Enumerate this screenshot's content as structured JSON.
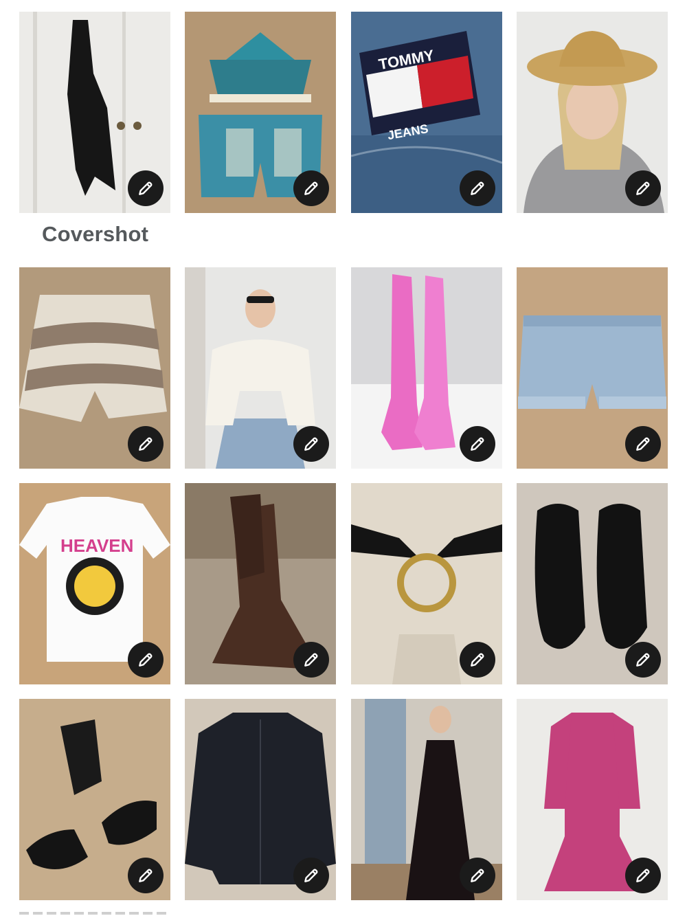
{
  "cover_label": "Covershot",
  "edit_icon": "pencil-icon",
  "colors": {
    "edit_button_bg": "#1b1b1b",
    "edit_icon": "#ffffff",
    "label": "#55595c"
  },
  "items": [
    {
      "name": "black-slip-dress",
      "brand_text": ""
    },
    {
      "name": "crochet-top-and-shorts-set",
      "brand_text": ""
    },
    {
      "name": "tommy-jeans-label",
      "brand_text": "TOMMY JEANS"
    },
    {
      "name": "woman-in-straw-hat",
      "brand_text": ""
    },
    {
      "name": "knit-striped-shorts",
      "brand_text": ""
    },
    {
      "name": "white-tie-front-top",
      "brand_text": ""
    },
    {
      "name": "pink-rain-boots",
      "brand_text": ""
    },
    {
      "name": "denim-shorts",
      "brand_text": ""
    },
    {
      "name": "heaven-graphic-tee",
      "brand_text": "HEAVEN"
    },
    {
      "name": "brown-cowboy-boots",
      "brand_text": ""
    },
    {
      "name": "black-ring-belt",
      "brand_text": ""
    },
    {
      "name": "black-suede-loafers",
      "brand_text": ""
    },
    {
      "name": "black-bow-sandals",
      "brand_text": ""
    },
    {
      "name": "black-denim-jacket",
      "brand_text": ""
    },
    {
      "name": "black-floral-maxi-dress",
      "brand_text": ""
    },
    {
      "name": "pink-print-dress",
      "brand_text": ""
    }
  ]
}
